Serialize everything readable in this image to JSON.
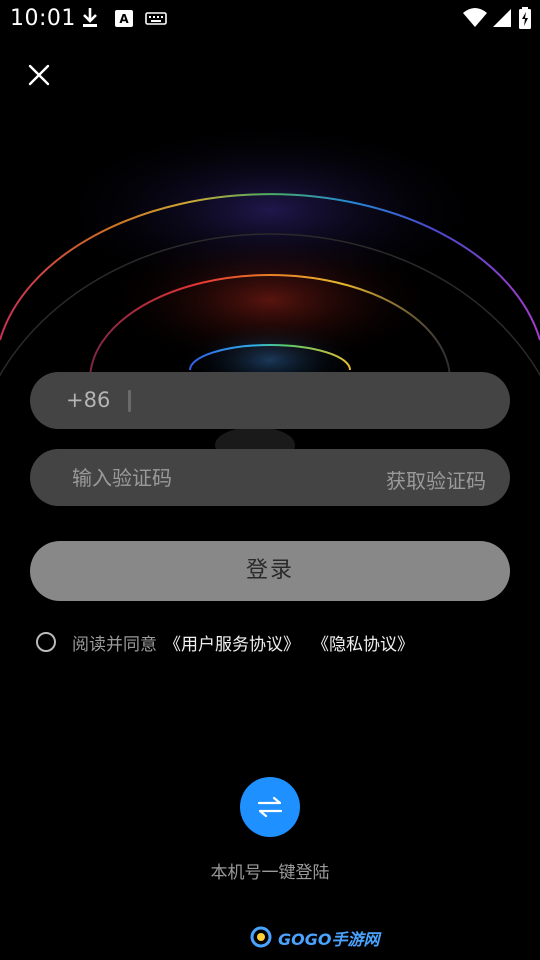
{
  "status_bar": {
    "time": "10:01",
    "icons": [
      "download-icon",
      "a-badge-icon",
      "keyboard-icon",
      "wifi-icon",
      "signal-icon",
      "battery-icon"
    ]
  },
  "login": {
    "phone": {
      "prefix": "+86",
      "value": ""
    },
    "code": {
      "placeholder": "输入验证码",
      "get_code_label": "获取验证码"
    },
    "submit_label": "登录",
    "agreement": {
      "text": "阅读并同意",
      "links": [
        "《用户服务协议》",
        "《隐私协议》"
      ]
    },
    "one_key": {
      "icon": "swap-icon",
      "label": "本机号一键登陆"
    }
  },
  "watermark": {
    "text": "GOGO手游网"
  },
  "colors": {
    "background": "#000000",
    "field": "#444444",
    "button": "#888888",
    "accent": "#1e90ff"
  }
}
